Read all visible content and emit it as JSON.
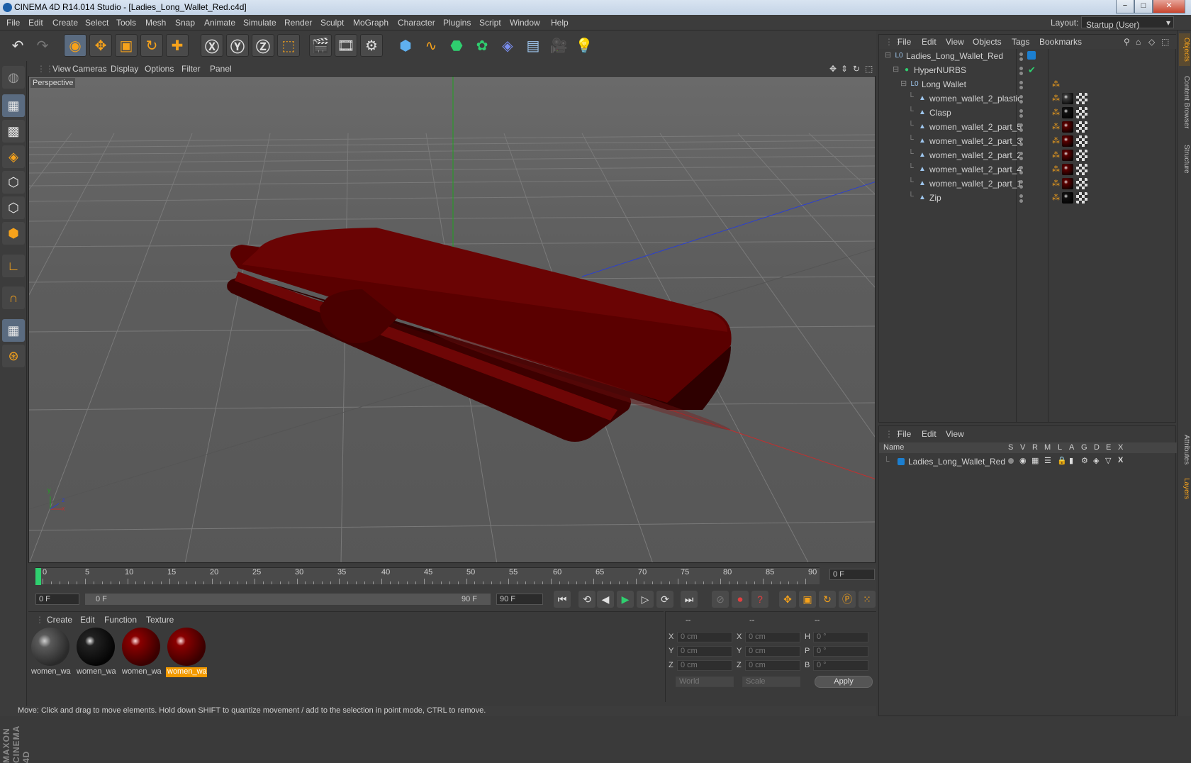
{
  "window": {
    "title": "CINEMA 4D R14.014 Studio - [Ladies_Long_Wallet_Red.c4d]",
    "minimize": "−",
    "maximize": "□",
    "close": "✕"
  },
  "menubar": {
    "items": [
      "File",
      "Edit",
      "Create",
      "Select",
      "Tools",
      "Mesh",
      "Snap",
      "Animate",
      "Simulate",
      "Render",
      "Sculpt",
      "MoGraph",
      "Character",
      "Plugins",
      "Script",
      "Window",
      "Help"
    ],
    "layout_label": "Layout:",
    "layout_value": "Startup (User)"
  },
  "viewport": {
    "menu": [
      "View",
      "Cameras",
      "Display",
      "Options",
      "Filter",
      "Panel"
    ],
    "label": "Perspective",
    "axis_x": "x",
    "axis_y": "y",
    "axis_z": "z"
  },
  "timeline": {
    "ticks": [
      "0",
      "5",
      "10",
      "15",
      "20",
      "25",
      "30",
      "35",
      "40",
      "45",
      "50",
      "55",
      "60",
      "65",
      "70",
      "75",
      "80",
      "85",
      "90"
    ],
    "current_frame": "0 F",
    "start_frame": "0 F",
    "range_start": "0 F",
    "range_end": "90 F",
    "end_frame": "90 F"
  },
  "materials": {
    "menu": [
      "Create",
      "Edit",
      "Function",
      "Texture"
    ],
    "items": [
      {
        "name": "women_wa",
        "color": "#3a3a3a"
      },
      {
        "name": "women_wa",
        "color": "#111111"
      },
      {
        "name": "women_wa",
        "color": "#5a0000"
      },
      {
        "name": "women_wa",
        "color": "#5a0000",
        "selected": true
      }
    ]
  },
  "coords": {
    "headers": [
      "--",
      "--",
      "--"
    ],
    "rows": [
      {
        "a": "X",
        "av": "0 cm",
        "b": "X",
        "bv": "0 cm",
        "c": "H",
        "cv": "0 °"
      },
      {
        "a": "Y",
        "av": "0 cm",
        "b": "Y",
        "bv": "0 cm",
        "c": "P",
        "cv": "0 °"
      },
      {
        "a": "Z",
        "av": "0 cm",
        "b": "Z",
        "bv": "0 cm",
        "c": "B",
        "cv": "0 °"
      }
    ],
    "space": "World",
    "mode": "Scale",
    "apply": "Apply"
  },
  "status": "Move: Click and drag to move elements. Hold down SHIFT to quantize movement / add to the selection in point mode, CTRL to remove.",
  "objects": {
    "menu": [
      "File",
      "Edit",
      "View",
      "Objects",
      "Tags",
      "Bookmarks"
    ],
    "rows": [
      {
        "name": "Ladies_Long_Wallet_Red",
        "indent": 0
      },
      {
        "name": "HyperNURBS",
        "indent": 1
      },
      {
        "name": "Long Wallet",
        "indent": 2
      },
      {
        "name": "women_wallet_2_plastic",
        "indent": 3,
        "mat": "#3a3a3a"
      },
      {
        "name": "Clasp",
        "indent": 3,
        "mat": "#111111"
      },
      {
        "name": "women_wallet_2_part_5",
        "indent": 3,
        "mat": "#5a0000"
      },
      {
        "name": "women_wallet_2_part_3",
        "indent": 3,
        "mat": "#5a0000"
      },
      {
        "name": "women_wallet_2_part_2",
        "indent": 3,
        "mat": "#5a0000"
      },
      {
        "name": "women_wallet_2_part_4",
        "indent": 3,
        "mat": "#5a0000"
      },
      {
        "name": "women_wallet_2_part_1",
        "indent": 3,
        "mat": "#5a0000"
      },
      {
        "name": "Zip",
        "indent": 3,
        "mat": "#111111"
      }
    ]
  },
  "layers": {
    "menu": [
      "File",
      "Edit",
      "View"
    ],
    "columns": [
      "Name",
      "S",
      "V",
      "R",
      "M",
      "L",
      "A",
      "G",
      "D",
      "E",
      "X"
    ],
    "row": "Ladies_Long_Wallet_Red"
  },
  "right_tabs": [
    "Objects",
    "Content Browser",
    "Structure",
    "Attributes",
    "Layers"
  ],
  "brand": "MAXON CINEMA 4D"
}
